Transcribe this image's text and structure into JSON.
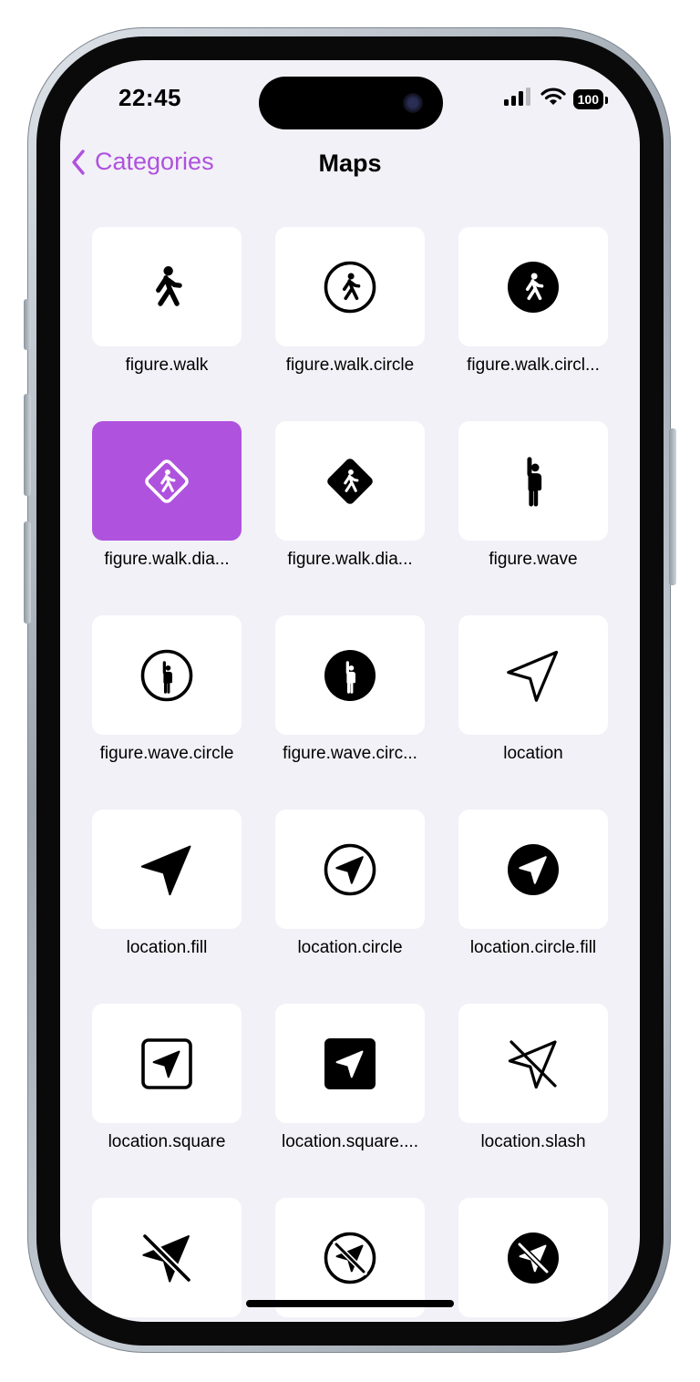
{
  "status_bar": {
    "time": "22:45",
    "battery": "100"
  },
  "nav": {
    "back_label": "Categories",
    "title": "Maps"
  },
  "colors": {
    "accent": "#af52de",
    "background": "#f2f1f7",
    "tile": "#ffffff"
  },
  "items": [
    {
      "label": "figure.walk",
      "icon": "figure-walk",
      "selected": false
    },
    {
      "label": "figure.walk.circle",
      "icon": "figure-walk-circle",
      "selected": false
    },
    {
      "label": "figure.walk.circl...",
      "icon": "figure-walk-circle-fill",
      "selected": false
    },
    {
      "label": "figure.walk.dia...",
      "icon": "figure-walk-diamond",
      "selected": true
    },
    {
      "label": "figure.walk.dia...",
      "icon": "figure-walk-diamond-fill",
      "selected": false
    },
    {
      "label": "figure.wave",
      "icon": "figure-wave",
      "selected": false
    },
    {
      "label": "figure.wave.circle",
      "icon": "figure-wave-circle",
      "selected": false
    },
    {
      "label": "figure.wave.circ...",
      "icon": "figure-wave-circle-fill",
      "selected": false
    },
    {
      "label": "location",
      "icon": "location",
      "selected": false
    },
    {
      "label": "location.fill",
      "icon": "location-fill",
      "selected": false
    },
    {
      "label": "location.circle",
      "icon": "location-circle",
      "selected": false
    },
    {
      "label": "location.circle.fill",
      "icon": "location-circle-fill",
      "selected": false
    },
    {
      "label": "location.square",
      "icon": "location-square",
      "selected": false
    },
    {
      "label": "location.square....",
      "icon": "location-square-fill",
      "selected": false
    },
    {
      "label": "location.slash",
      "icon": "location-slash",
      "selected": false
    },
    {
      "label": "",
      "icon": "location-slash-fill",
      "selected": false
    },
    {
      "label": "",
      "icon": "location-slash-circle",
      "selected": false
    },
    {
      "label": "",
      "icon": "location-slash-circle-fill",
      "selected": false
    }
  ]
}
